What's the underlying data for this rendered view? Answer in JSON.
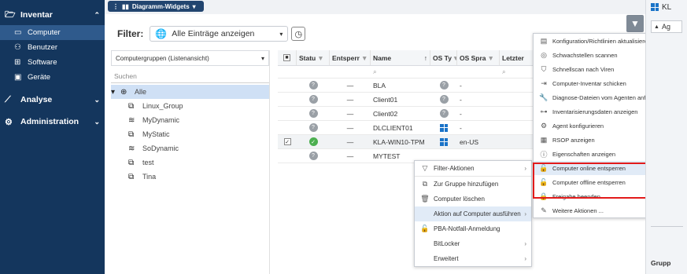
{
  "sidebar": {
    "sections": [
      {
        "label": "Inventar",
        "icon": "folder-icon",
        "chevron": "⌃",
        "items": [
          {
            "label": "Computer",
            "icon": "monitor-icon",
            "active": true
          },
          {
            "label": "Benutzer",
            "icon": "users-icon"
          },
          {
            "label": "Software",
            "icon": "software-icon"
          },
          {
            "label": "Geräte",
            "icon": "device-icon"
          }
        ]
      },
      {
        "label": "Analyse",
        "icon": "chart-icon",
        "chevron": "⌄"
      },
      {
        "label": "Administration",
        "icon": "admin-icon",
        "chevron": "⌄"
      }
    ]
  },
  "topbar": {
    "widget_label": "Diagramm-Widgets"
  },
  "filter": {
    "label": "Filter:",
    "value": "Alle Einträge anzeigen"
  },
  "groups": {
    "header": "Computergruppen (Listenansicht)",
    "search_placeholder": "Suchen",
    "items": [
      {
        "label": "Alle",
        "icon": "globe-icon",
        "selected": true
      },
      {
        "label": "Linux_Group",
        "icon": "computer-group-icon"
      },
      {
        "label": "MyDynamic",
        "icon": "dynamic-group-icon"
      },
      {
        "label": "MyStatic",
        "icon": "computer-group-icon"
      },
      {
        "label": "SoDynamic",
        "icon": "dynamic-group-icon"
      },
      {
        "label": "test",
        "icon": "computer-group-icon"
      },
      {
        "label": "Tina",
        "icon": "computer-group-icon"
      }
    ]
  },
  "grid": {
    "columns": [
      "Statu",
      "Entsperr",
      "Name",
      "OS Ty",
      "OS Spra",
      "Letzter"
    ],
    "rows": [
      {
        "name": "BLA",
        "os_lang": "-",
        "status": "unknown",
        "lock": "—",
        "os": "unknown"
      },
      {
        "name": "Client01",
        "os_lang": "-",
        "status": "unknown",
        "lock": "—",
        "os": "unknown"
      },
      {
        "name": "Client02",
        "os_lang": "-",
        "status": "unknown",
        "lock": "—",
        "os": "unknown"
      },
      {
        "name": "DLCLIENT01",
        "os_lang": "-",
        "status": "unknown",
        "lock": "—",
        "os": "windows"
      },
      {
        "name": "KLA-WIN10-TPM",
        "os_lang": "en-US",
        "status": "ok",
        "lock": "—",
        "os": "windows",
        "selected": true
      },
      {
        "name": "MYTEST",
        "os_lang": "",
        "status": "unknown",
        "lock": "—",
        "os": ""
      }
    ]
  },
  "context_menu": {
    "items": [
      {
        "label": "Filter-Aktionen",
        "icon": "filter-icon",
        "submenu": true
      },
      {
        "label": "Zur Gruppe hinzufügen",
        "icon": "add-group-icon"
      },
      {
        "label": "Computer löschen",
        "icon": "trash-icon"
      },
      {
        "label": "Aktion auf Computer ausführen",
        "icon": "",
        "submenu": true,
        "highlight": true
      },
      {
        "label": "PBA-Notfall-Anmeldung",
        "icon": "unlock-icon"
      },
      {
        "label": "BitLocker",
        "icon": "",
        "submenu": true
      },
      {
        "label": "Erweitert",
        "icon": "",
        "submenu": true
      }
    ]
  },
  "submenu": {
    "items": [
      {
        "label": "Konfiguration/Richtlinien aktualisieren",
        "icon": "config-icon"
      },
      {
        "label": "Schwachstellen scannen",
        "icon": "scan-icon"
      },
      {
        "label": "Schnellscan nach Viren",
        "icon": "shield-icon"
      },
      {
        "label": "Computer-Inventar schicken",
        "icon": "inventory-icon"
      },
      {
        "label": "Diagnose-Dateien vom Agenten anfordern",
        "icon": "wrench-icon"
      },
      {
        "label": "Inventarisierungsdaten anzeigen",
        "icon": "data-icon"
      },
      {
        "label": "Agent konfigurieren",
        "icon": "gear-icon"
      },
      {
        "label": "RSOP anzeigen",
        "icon": "rsop-icon"
      },
      {
        "label": "Eigenschaften anzeigen",
        "icon": "info-icon"
      },
      {
        "label": "Computer online entsperren",
        "icon": "unlock-icon",
        "highlight": true
      },
      {
        "label": "Computer offline entsperren",
        "icon": "unlock-icon"
      },
      {
        "label": "Freigabe beenden",
        "icon": "lock-icon"
      },
      {
        "label": "Weitere Aktionen ...",
        "icon": "edit-icon"
      }
    ]
  },
  "right_panel": {
    "title": "KL",
    "tree_label": "Ag",
    "group_label": "Grupp"
  },
  "colors": {
    "sidebar": "#14365d",
    "accent": "#22456f",
    "highlight": "#e1ebf7",
    "red_box": "#e21b1b"
  }
}
